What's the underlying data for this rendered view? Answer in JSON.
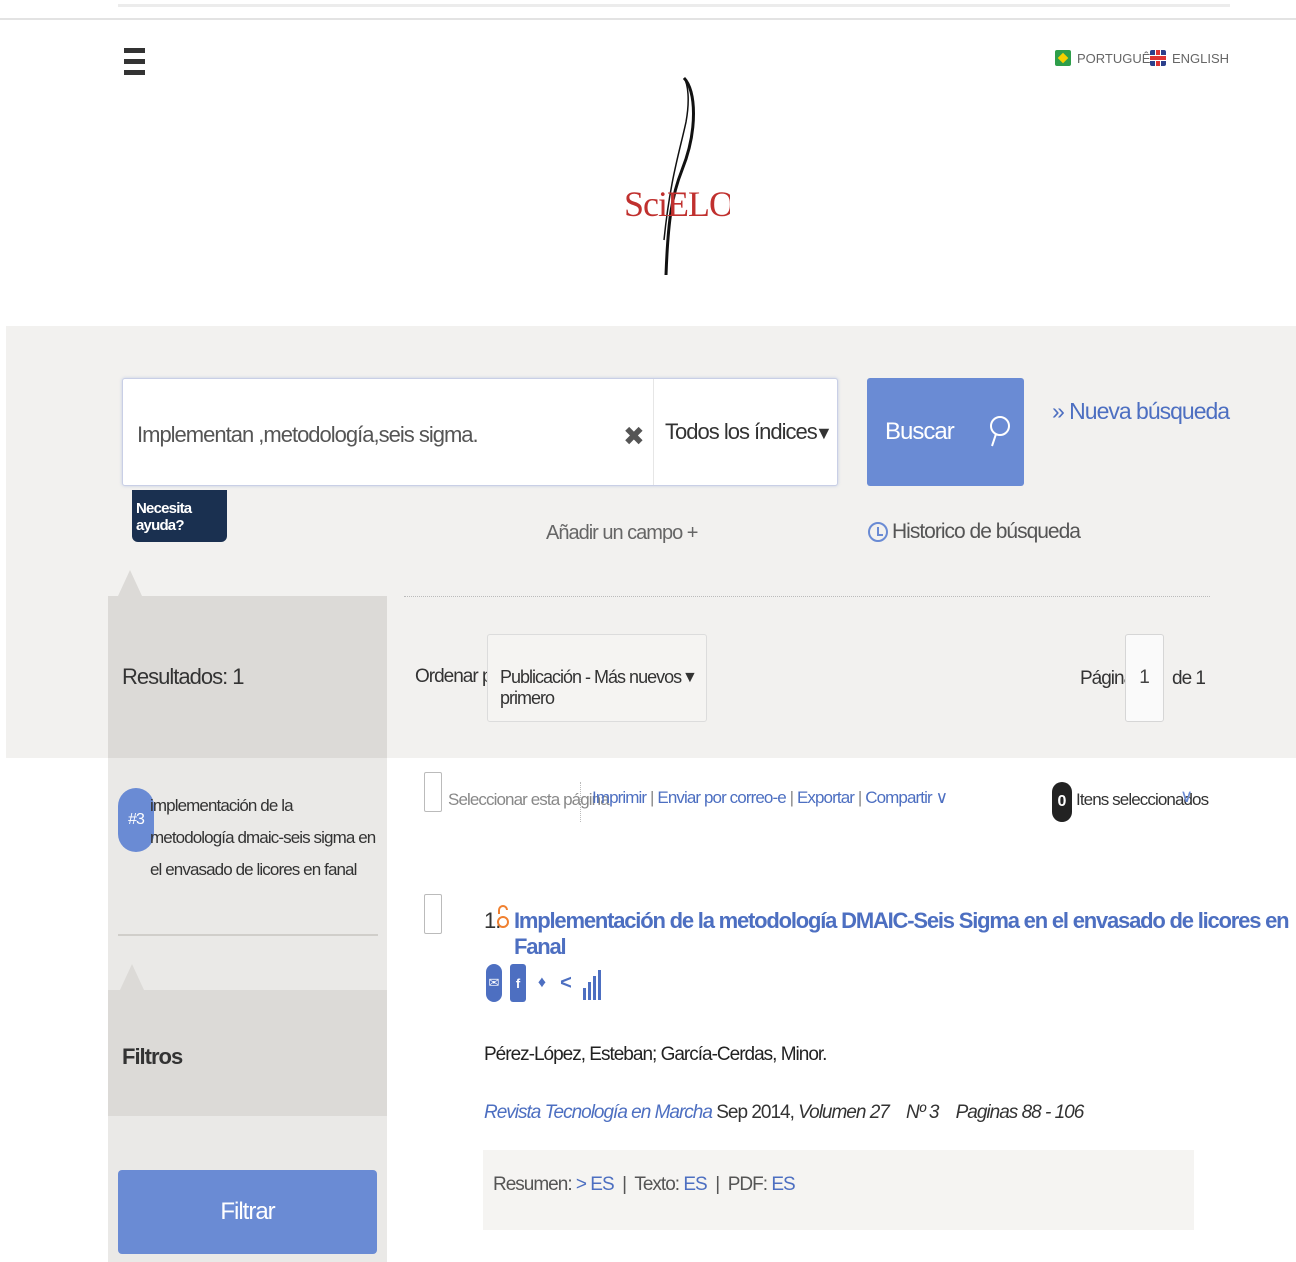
{
  "header": {
    "languages": [
      {
        "label": "PORTUGUÊS",
        "flag": "brazil-flag-icon"
      },
      {
        "label": "ENGLISH",
        "flag": "uk-flag-icon"
      }
    ],
    "logo_text": "SciELO"
  },
  "search": {
    "query": "Implementan ,metodología,seis sigma.",
    "index_select": "Todos los índices",
    "button_label": "Buscar",
    "new_search": "» Nueva búsqueda",
    "help": "Necesita ayuda?",
    "add_field": "Añadir un campo +",
    "history": "Historico de búsqueda"
  },
  "sidebar": {
    "results_label": "Resultados: 1",
    "history_badge": "#3",
    "history_query": "implementación de la metodología dmaic-seis sigma en el envasado de licores en fanal",
    "filters_label": "Filtros",
    "filter_button": "Filtrar"
  },
  "results_header": {
    "order_label": "Ordenar por",
    "order_value": "Publicación - Más nuevos primero",
    "page_label": "Página",
    "page_value": "1",
    "page_total": "de 1"
  },
  "toolbar": {
    "select_page": "Seleccionar esta página",
    "print": "Imprimir",
    "email": "Enviar por correo-e",
    "export": "Exportar",
    "share": "Compartir",
    "selected_count": "0",
    "selected_label": "Itens seleccionados"
  },
  "result": {
    "number": "1.",
    "title": "Implementación de la metodología DMAIC-Seis Sigma en el envasado de licores en Fanal",
    "authors": "Pérez-López, Esteban; García-Cerdas, Minor.",
    "journal": "Revista Tecnología en Marcha",
    "date": "Sep 2014,",
    "volume": "Volumen 27",
    "number_label": "Nº 3",
    "pages": "Paginas 88 - 106",
    "resumen_label": "Resumen:",
    "resumen_lang": "ES",
    "texto_label": "Texto:",
    "texto_lang": "ES",
    "pdf_label": "PDF:",
    "pdf_lang": "ES"
  },
  "colors": {
    "accent": "#6a8bd4",
    "link": "#4d6fc1",
    "help_bg": "#1a3050",
    "logo_red": "#c0302e"
  }
}
